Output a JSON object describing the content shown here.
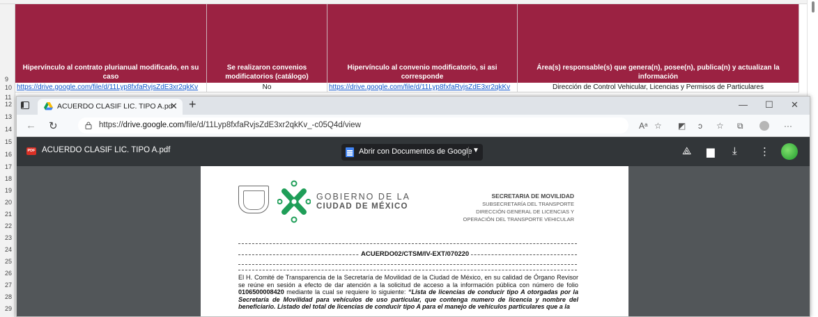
{
  "spreadsheet": {
    "row_numbers": [
      "9",
      "10",
      "11",
      "12",
      "13",
      "14",
      "15",
      "16",
      "17",
      "18",
      "19",
      "20",
      "21",
      "22",
      "23",
      "24",
      "25",
      "26",
      "27",
      "28",
      "29"
    ],
    "headers": [
      "Hipervínculo al contrato plurianual modificado, en su caso",
      "Se realizaron convenios modificatorios (catálogo)",
      "Hipervínculo al convenio modificatorio, si asi corresponde",
      "Área(s) responsable(s) que genera(n), posee(n), publica(n) y actualizan la información"
    ],
    "row10": [
      "https://drive.google.com/file/d/11Lyp8fxfaRvjsZdE3xr2qkKv",
      "No",
      "https://drive.google.com/file/d/11Lyp8fxfaRvjsZdE3xr2qkKv",
      "Dirección de Control Vehicular, Licencias y Permisos de Particulares"
    ],
    "header_color": "#9b2242"
  },
  "browser": {
    "tab_title": "ACUERDO CLASIF LIC. TIPO A.pd",
    "url_prefix": "https://",
    "url_domain": "drive.google.com",
    "url_path": "/file/d/11Lyp8fxfaRvjsZdE3xr2qkKv_-c05Q4d/view",
    "reader_glyph": "Aᵃ"
  },
  "pdf_viewer": {
    "badge": "PDF",
    "file_name": "ACUERDO CLASIF LIC. TIPO A.pdf",
    "open_with_label": "Abrir con Documentos de Google"
  },
  "document": {
    "gov_line1": "GOBIERNO DE LA",
    "gov_line2": "CIUDAD DE MÉXICO",
    "sec_line1": "SECRETARIA DE MOVILIDAD",
    "sec_line2": "SUBSECRETARÍA DEL TRANSPORTE",
    "sec_line3": "DIRECCIÓN GENERAL DE LICENCIAS Y",
    "sec_line4": "OPERACIÓN DEL TRANSPORTE VEHICULAR",
    "acuerdo": "ACUERDO02/CTSM/IV-EXT/070220",
    "para_1": "El H. Comité de Transparencia de la Secretaría de Movilidad de la Ciudad de México, en su calidad de Órgano Revisor se reúne en sesión a efecto de dar atención a la solicitud de acceso a la información pública con número de folio ",
    "folio": "0106500008420",
    "para_2": " mediante la cual se requiere lo siguiente: ",
    "quote": "“Lista de licencias de conducir tipo A otorgadas por la Secretaría de Movilidad para vehículos de uso particular, que contenga numero de licencia y nombre del beneficiario. Listado del total de licencias de conducir tipo A para el manejo de vehículos particulares que a la"
  }
}
